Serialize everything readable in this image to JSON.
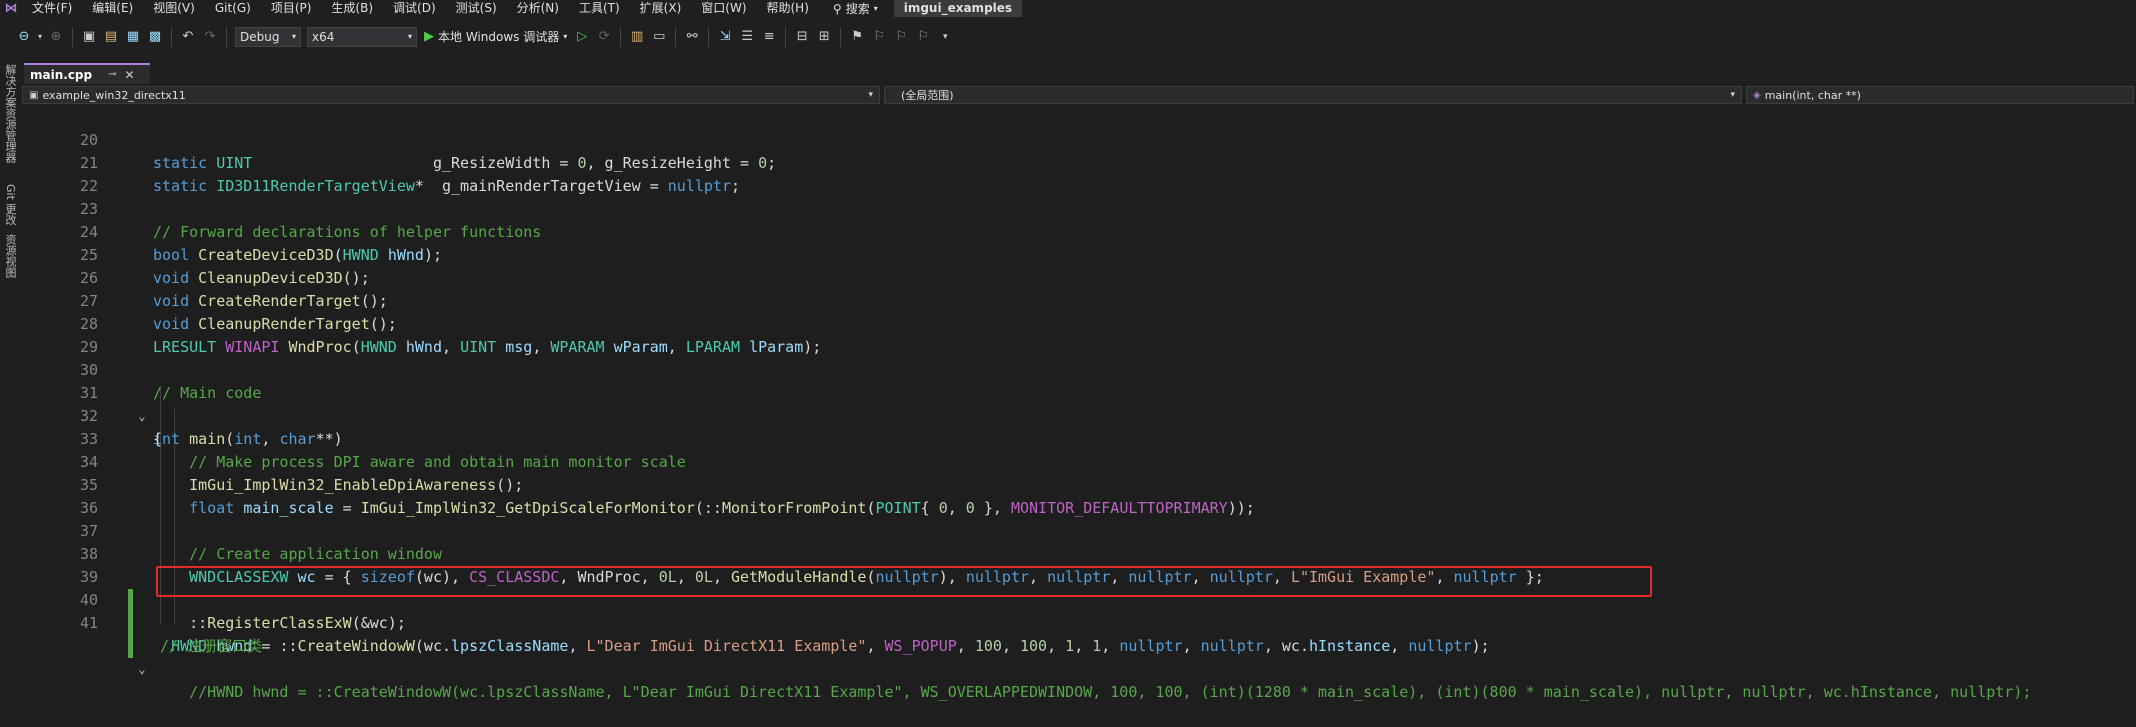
{
  "menu": {
    "items": [
      "文件(F)",
      "编辑(E)",
      "视图(V)",
      "Git(G)",
      "项目(P)",
      "生成(B)",
      "调试(D)",
      "测试(S)",
      "分析(N)",
      "工具(T)",
      "扩展(X)",
      "窗口(W)",
      "帮助(H)"
    ],
    "search_label": "搜索",
    "solution_name": "imgui_examples"
  },
  "toolbar": {
    "configuration": "Debug",
    "platform": "x64",
    "run_label": "本地 Windows 调试器"
  },
  "left_panel": {
    "labels": [
      "解决方案资源管理器",
      "Git 更改",
      "资源视图"
    ]
  },
  "tabs": [
    {
      "label": "main.cpp",
      "pin": "⊸",
      "close": "✕"
    }
  ],
  "navbar": {
    "project": "example_win32_directx11",
    "scope": "(全局范围)",
    "member": "main(int, char **)"
  },
  "editor": {
    "line_numbers": [
      "20",
      "21",
      "22",
      "23",
      "24",
      "25",
      "26",
      "27",
      "28",
      "29",
      "30",
      "31",
      "32",
      "33",
      "34",
      "35",
      "36",
      "37",
      "38",
      "39",
      "40",
      "41"
    ]
  },
  "colors": {
    "accent": "#b180d7",
    "highlight_box": "#e02b2b",
    "modified_bar": "#57a64a"
  }
}
